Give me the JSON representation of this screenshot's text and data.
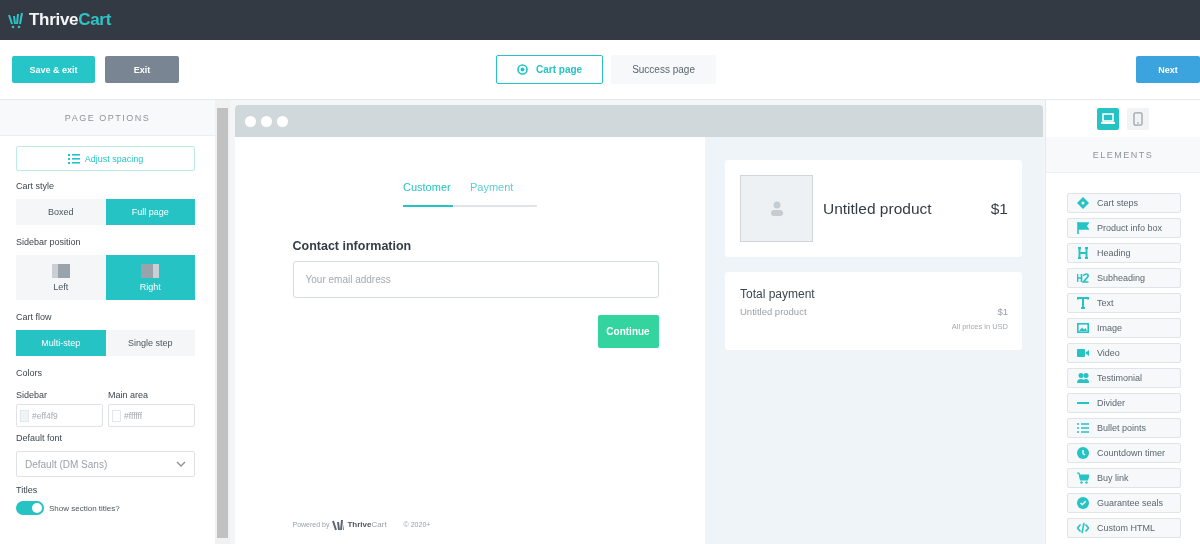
{
  "app_bar": {
    "logo_parts": [
      "Thrive",
      "Cart"
    ]
  },
  "toolbar": {
    "save_button": "Save & exit",
    "exit_button": "Exit",
    "next_button": "Next",
    "page_tabs": [
      {
        "label": "Cart page",
        "selected": true
      },
      {
        "label": "Success page",
        "selected": false
      }
    ]
  },
  "page_options": {
    "title": "PAGE OPTIONS",
    "adjust_spacing": "Adjust spacing",
    "groups": [
      {
        "label": "Cart style",
        "kind": "plain",
        "options": [
          {
            "label": "Boxed",
            "selected": false
          },
          {
            "label": "Full page",
            "selected": true
          }
        ]
      },
      {
        "label": "Sidebar position",
        "kind": "layout",
        "options": [
          {
            "label": "Left",
            "selected": false
          },
          {
            "label": "Right",
            "selected": true
          }
        ]
      },
      {
        "label": "Cart flow",
        "kind": "plain",
        "options": [
          {
            "label": "Multi-step",
            "selected": true
          },
          {
            "label": "Single step",
            "selected": false
          }
        ]
      }
    ],
    "colors_label": "Colors",
    "color_fields": [
      {
        "label": "Sidebar",
        "value": "#eff4f9",
        "color": "#eff4f9"
      },
      {
        "label": "Main area",
        "value": "#ffffff",
        "color": "#ffffff"
      }
    ],
    "font_label": "Default font",
    "font_value": "Default (DM Sans)",
    "titles_label": "Titles",
    "titles_toggle": {
      "label": "Show section titles?",
      "on": true
    }
  },
  "preview": {
    "steps": [
      {
        "label": "Customer",
        "selected": true
      },
      {
        "label": "Payment",
        "selected": false
      }
    ],
    "contact_heading": "Contact information",
    "email_placeholder": "Your email address",
    "continue_button": "Continue",
    "footer": {
      "powered_by": "Powered by",
      "logo_parts": [
        "Thrive",
        "Cart"
      ],
      "copyright": "© 2020+"
    },
    "product": {
      "name": "Untitled product",
      "price": "$1"
    },
    "total": {
      "title": "Total payment",
      "item": "Untitled product",
      "amount": "$1",
      "note": "All prices in USD"
    }
  },
  "elements_panel": {
    "devices": [
      {
        "selected": true
      },
      {
        "selected": false
      }
    ],
    "title": "ELEMENTS",
    "items": [
      "Cart steps",
      "Product info box",
      "Heading",
      "Subheading",
      "Text",
      "Image",
      "Video",
      "Testimonial",
      "Divider",
      "Bullet points",
      "Countdown timer",
      "Buy link",
      "Guarantee seals",
      "Custom HTML"
    ]
  }
}
